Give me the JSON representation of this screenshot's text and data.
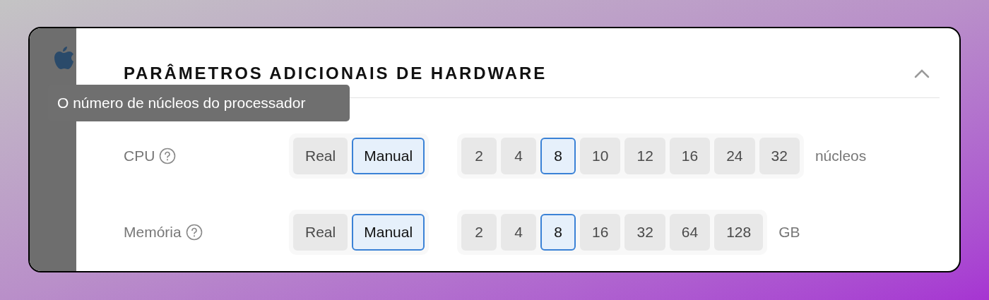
{
  "section": {
    "title": "PARÂMETROS ADICIONAIS DE HARDWARE",
    "expanded": true
  },
  "tooltip": {
    "text": "O número de núcleos do processador"
  },
  "rows": [
    {
      "label": "CPU",
      "modes": [
        {
          "label": "Real",
          "selected": false
        },
        {
          "label": "Manual",
          "selected": true
        }
      ],
      "options": [
        {
          "label": "2",
          "selected": false
        },
        {
          "label": "4",
          "selected": false
        },
        {
          "label": "8",
          "selected": true
        },
        {
          "label": "10",
          "selected": false
        },
        {
          "label": "12",
          "selected": false
        },
        {
          "label": "16",
          "selected": false
        },
        {
          "label": "24",
          "selected": false
        },
        {
          "label": "32",
          "selected": false
        }
      ],
      "unit": "núcleos"
    },
    {
      "label": "Memória",
      "modes": [
        {
          "label": "Real",
          "selected": false
        },
        {
          "label": "Manual",
          "selected": true
        }
      ],
      "options": [
        {
          "label": "2",
          "selected": false
        },
        {
          "label": "4",
          "selected": false
        },
        {
          "label": "8",
          "selected": true
        },
        {
          "label": "16",
          "selected": false
        },
        {
          "label": "32",
          "selected": false
        },
        {
          "label": "64",
          "selected": false
        },
        {
          "label": "128",
          "selected": false
        }
      ],
      "unit": "GB"
    }
  ]
}
